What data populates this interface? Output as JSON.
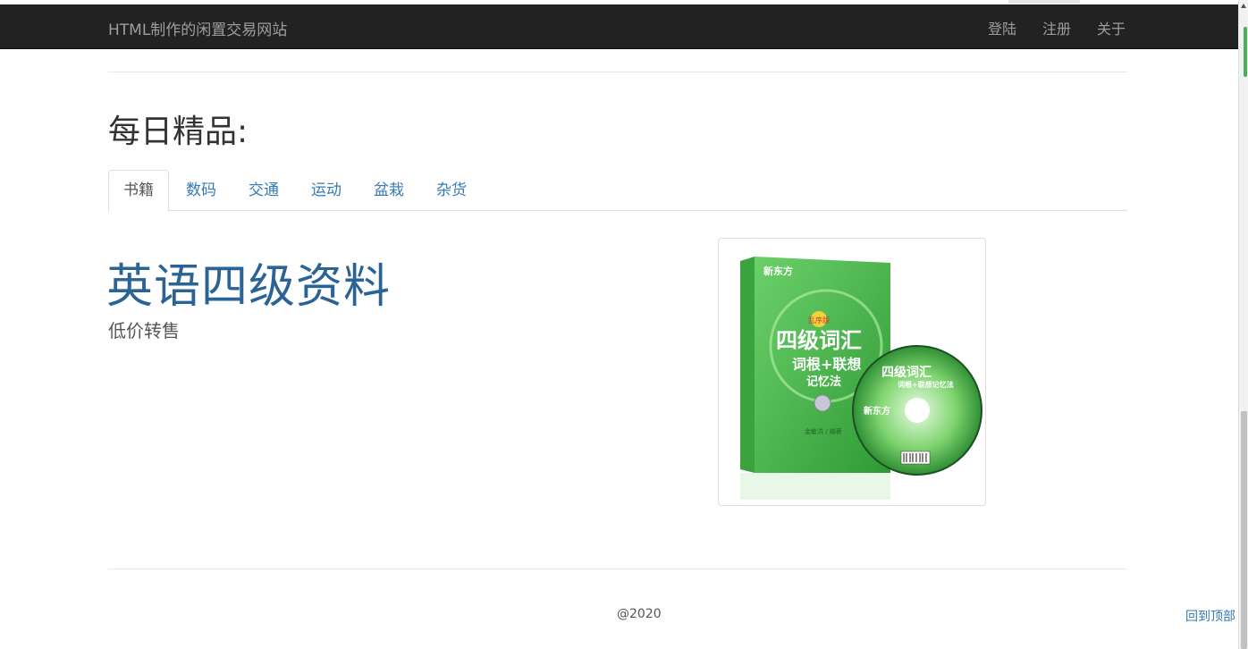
{
  "navbar": {
    "brand": "HTML制作的闲置交易网站",
    "links": [
      "登陆",
      "注册",
      "关于"
    ]
  },
  "section": {
    "title": "每日精品:"
  },
  "tabs": [
    {
      "label": "书籍",
      "active": true
    },
    {
      "label": "数码",
      "active": false
    },
    {
      "label": "交通",
      "active": false
    },
    {
      "label": "运动",
      "active": false
    },
    {
      "label": "盆栽",
      "active": false
    },
    {
      "label": "杂货",
      "active": false
    }
  ],
  "product": {
    "title": "英语四级资料",
    "subtitle": "低价转售",
    "image": {
      "brand": "新东方",
      "book_title": "四级词汇",
      "book_sub1": "词根+联想",
      "book_sub2": "记忆法",
      "badge": "乱序版",
      "disc_title": "四级词汇",
      "disc_sub": "词根+联想记忆法",
      "author": "金敏洪 / 编著"
    }
  },
  "footer": {
    "copyright": "@2020",
    "back_to_top": "回到顶部"
  },
  "colors": {
    "navbar": "#222222",
    "link": "#337ab7",
    "title_blue": "#2a6496",
    "book_green": "#4cb848"
  }
}
